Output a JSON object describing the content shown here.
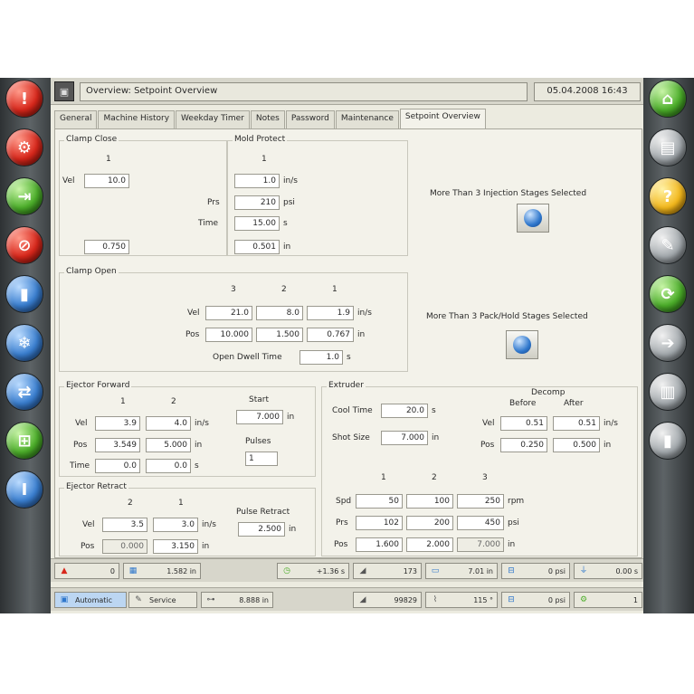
{
  "header": {
    "title": "Overview: Setpoint Overview",
    "datetime": "05.04.2008 16:43"
  },
  "tabs": [
    "General",
    "Machine History",
    "Weekday Timer",
    "Notes",
    "Password",
    "Maintenance",
    "Setpoint Overview"
  ],
  "clamp_close": {
    "title": "Clamp Close",
    "stage": "1",
    "vel_label": "Vel",
    "vel": "10.0",
    "pos": "0.750"
  },
  "mold_protect": {
    "title": "Mold Protect",
    "stage": "1",
    "vel": "1.0",
    "vel_unit": "in/s",
    "prs_label": "Prs",
    "prs": "210",
    "prs_unit": "psi",
    "time_label": "Time",
    "time": "15.00",
    "time_unit": "s",
    "pos": "0.501",
    "pos_unit": "in"
  },
  "injection_msg": "More Than 3 Injection Stages Selected",
  "packhold_msg": "More Than 3 Pack/Hold Stages Selected",
  "clamp_open": {
    "title": "Clamp Open",
    "stages": [
      "3",
      "2",
      "1"
    ],
    "vel_label": "Vel",
    "vel": [
      "21.0",
      "8.0",
      "1.9"
    ],
    "vel_unit": "in/s",
    "pos_label": "Pos",
    "pos": [
      "10.000",
      "1.500",
      "0.767"
    ],
    "pos_unit": "in",
    "open_dwell_label": "Open Dwell Time",
    "open_dwell": "1.0",
    "open_dwell_unit": "s"
  },
  "ejector_forward": {
    "title": "Ejector Forward",
    "stages": [
      "1",
      "2"
    ],
    "vel_label": "Vel",
    "vel": [
      "3.9",
      "4.0"
    ],
    "vel_unit": "in/s",
    "pos_label": "Pos",
    "pos": [
      "3.549",
      "5.000"
    ],
    "pos_unit": "in",
    "time_label": "Time",
    "time": [
      "0.0",
      "0.0"
    ],
    "time_unit": "s",
    "start_label": "Start",
    "start": "7.000",
    "start_unit": "in",
    "pulses_label": "Pulses",
    "pulses": "1"
  },
  "ejector_retract": {
    "title": "Ejector Retract",
    "stages": [
      "2",
      "1"
    ],
    "vel_label": "Vel",
    "vel": [
      "3.5",
      "3.0"
    ],
    "vel_unit": "in/s",
    "pos_label": "Pos",
    "pos": [
      "0.000",
      "3.150"
    ],
    "pos_unit": "in",
    "pulse_retract_label": "Pulse Retract",
    "pulse_retract": "2.500",
    "pulse_retract_unit": "in"
  },
  "extruder": {
    "title": "Extruder",
    "cool_time_label": "Cool Time",
    "cool_time": "20.0",
    "cool_time_unit": "s",
    "shot_size_label": "Shot Size",
    "shot_size": "7.000",
    "shot_size_unit": "in",
    "decomp_label": "Decomp",
    "before_label": "Before",
    "after_label": "After",
    "decomp_vel_label": "Vel",
    "decomp_vel": [
      "0.51",
      "0.51"
    ],
    "decomp_vel_unit": "in/s",
    "decomp_pos_label": "Pos",
    "decomp_pos": [
      "0.250",
      "0.500"
    ],
    "decomp_pos_unit": "in",
    "stages": [
      "1",
      "2",
      "3"
    ],
    "spd_label": "Spd",
    "spd": [
      "50",
      "100",
      "250"
    ],
    "spd_unit": "rpm",
    "prs_label": "Prs",
    "prs": [
      "102",
      "200",
      "450"
    ],
    "prs_unit": "psi",
    "pos_label": "Pos",
    "pos": [
      "1.600",
      "2.000",
      "7.000"
    ],
    "pos_unit": "in"
  },
  "status_row1": [
    "0",
    "1.582 in",
    "+1.36 s",
    "173",
    "7.01 in",
    "0 psi",
    "0.00 s"
  ],
  "status_row2": [
    "Automatic",
    "Service",
    "8.888 in",
    "99829",
    "115 °",
    "0 psi",
    "1"
  ],
  "colors": {
    "panel_bg": "#f3f2ea",
    "frame": "#4a4f52",
    "alarm_red": "#d8271b",
    "accent_blue": "#2f77cc"
  }
}
